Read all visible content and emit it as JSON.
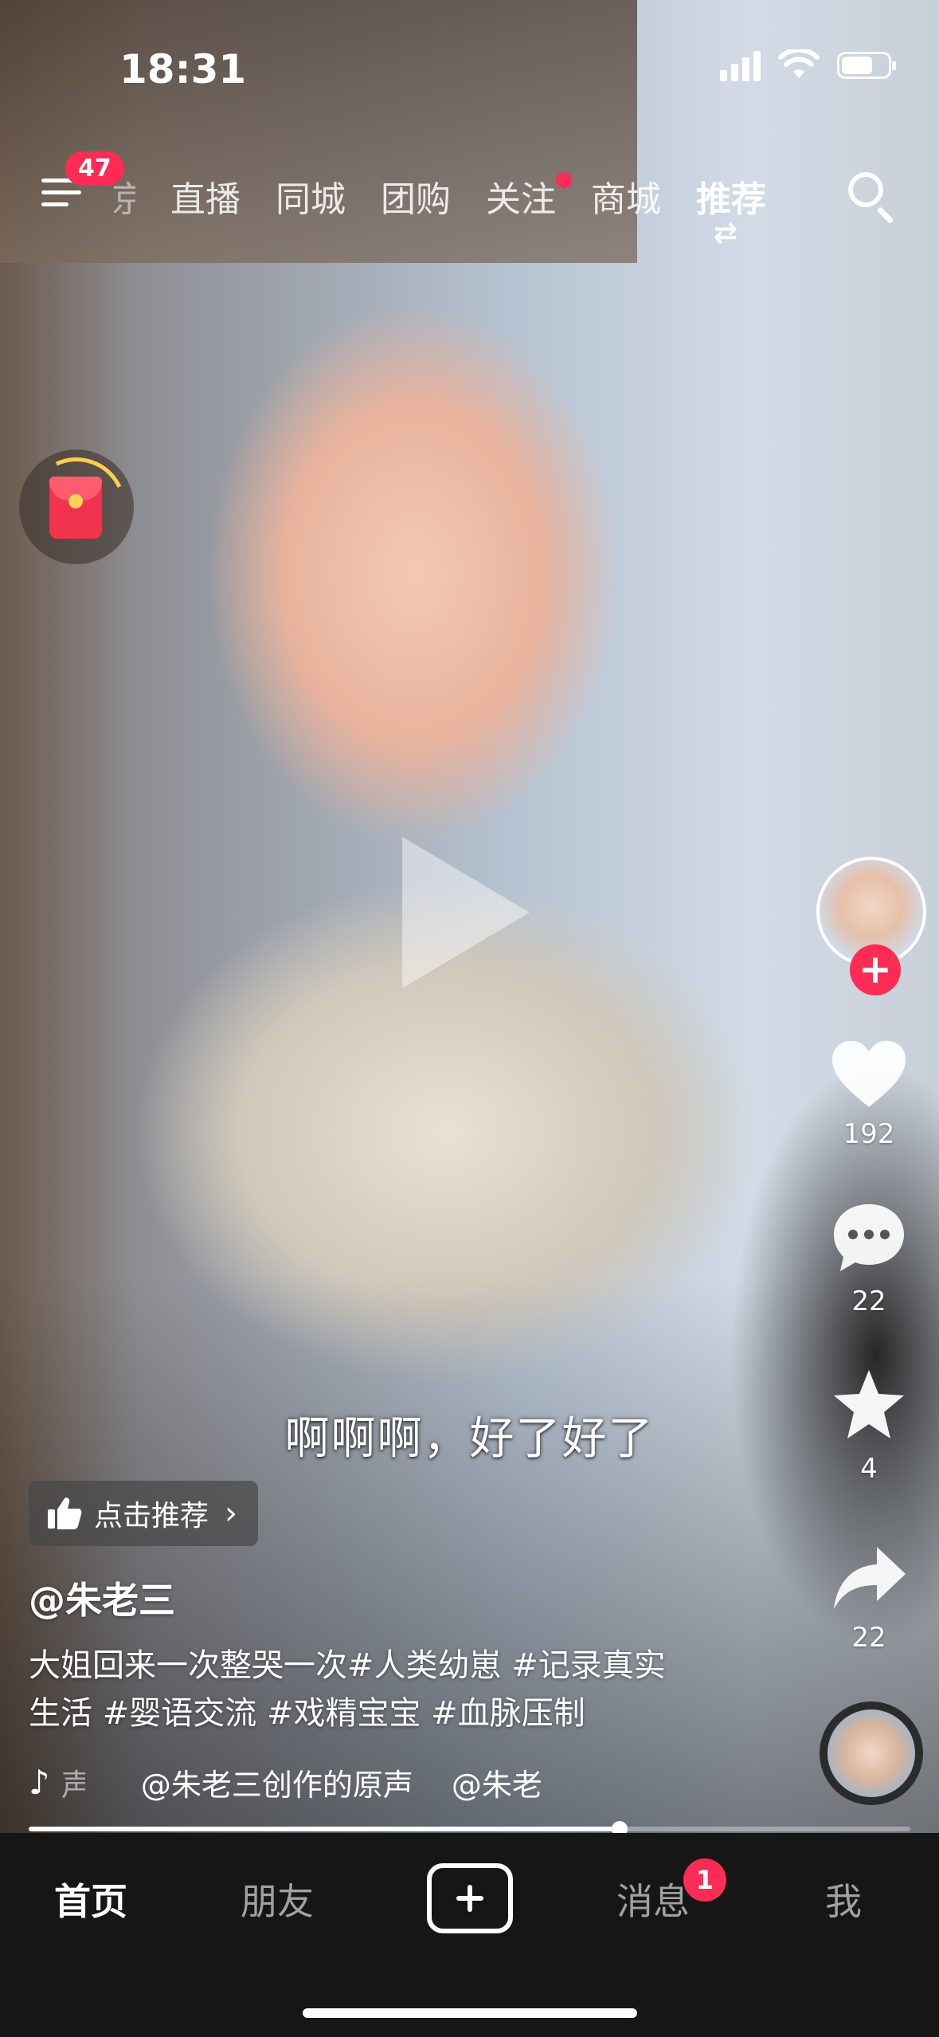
{
  "status_bar": {
    "time": "18:31"
  },
  "top_nav": {
    "menu_badge": "47",
    "tabs": [
      {
        "label": "京"
      },
      {
        "label": "直播"
      },
      {
        "label": "同城"
      },
      {
        "label": "团购"
      },
      {
        "label": "关注"
      },
      {
        "label": "商城"
      },
      {
        "label": "推荐"
      }
    ],
    "active_tab": "推荐",
    "follow_dot": true
  },
  "video": {
    "subtitle": "啊啊啊，好了好了",
    "recommend_label": "点击推荐",
    "author": "@朱老三",
    "caption_line1": "大姐回来一次整哭一次#人类幼崽 #记录真实",
    "caption_line2": "生活 #婴语交流 #戏精宝宝 #血脉压制",
    "music_ghost": "声",
    "music_title": "@朱老三创作的原声",
    "music_author": "@朱老",
    "progress": 0.67
  },
  "actions": {
    "likes": "192",
    "comments": "22",
    "favorites": "4",
    "shares": "22"
  },
  "tab_bar": {
    "home": "首页",
    "friends": "朋友",
    "messages": "消息",
    "messages_badge": "1",
    "me": "我"
  },
  "colors": {
    "accent": "#fe2c55",
    "tab_bar_bg": "#161616"
  }
}
